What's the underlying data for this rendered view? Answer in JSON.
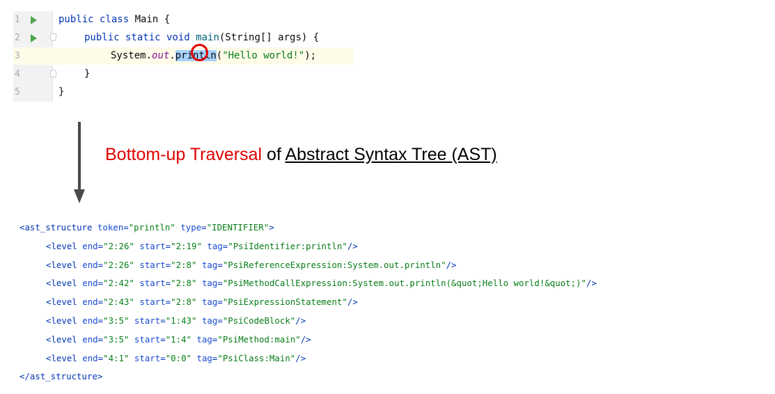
{
  "editor": {
    "lines": [
      {
        "num": "1",
        "tokens": [
          "public class ",
          "Main",
          " {"
        ]
      },
      {
        "num": "2",
        "tokens": [
          "public static void ",
          "main",
          "(String[] args) {"
        ]
      },
      {
        "num": "3",
        "tokens": [
          "System.",
          "out",
          ".",
          "println",
          "(",
          "\"Hello world!\"",
          ");"
        ]
      },
      {
        "num": "4",
        "tokens": [
          "}"
        ]
      },
      {
        "num": "5",
        "tokens": [
          "}"
        ]
      }
    ]
  },
  "caption": {
    "red_part": "Bottom-up Traversal",
    "middle": " of ",
    "underlined": "Abstract Syntax Tree (AST)"
  },
  "ast": {
    "open": {
      "tag": "ast_structure",
      "attrs": [
        [
          "token",
          "println"
        ],
        [
          "type",
          "IDENTIFIER"
        ]
      ]
    },
    "levels": [
      {
        "end": "2:26",
        "start": "2:19",
        "tag": "PsiIdentifier:println"
      },
      {
        "end": "2:26",
        "start": "2:8",
        "tag": "PsiReferenceExpression:System.out.println"
      },
      {
        "end": "2:42",
        "start": "2:8",
        "tag": "PsiMethodCallExpression:System.out.println(&quot;Hello world!&quot;)"
      },
      {
        "end": "2:43",
        "start": "2:8",
        "tag": "PsiExpressionStatement"
      },
      {
        "end": "3:5",
        "start": "1:43",
        "tag": "PsiCodeBlock"
      },
      {
        "end": "3:5",
        "start": "1:4",
        "tag": "PsiMethod:main"
      },
      {
        "end": "4:1",
        "start": "0:0",
        "tag": "PsiClass:Main"
      }
    ],
    "level_tag": "level",
    "close": "ast_structure"
  }
}
